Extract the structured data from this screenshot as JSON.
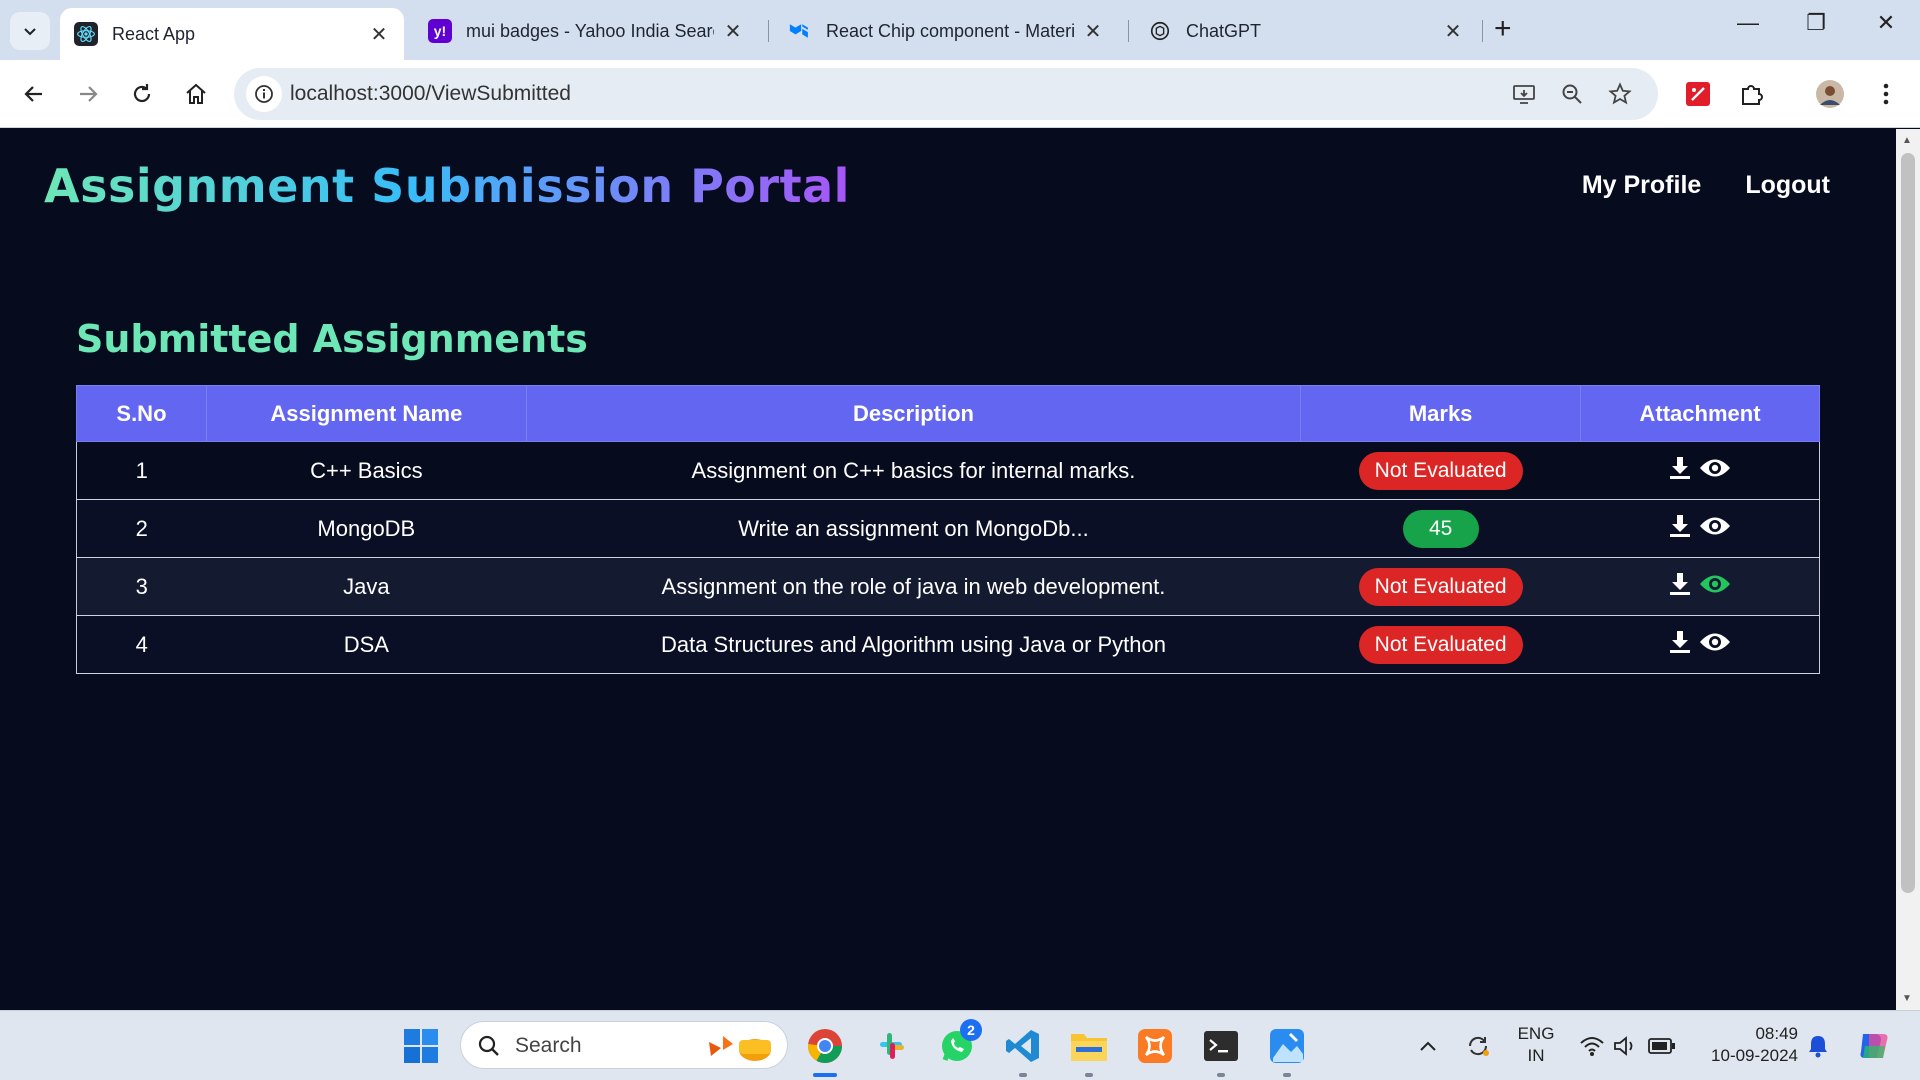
{
  "browser": {
    "tabs": [
      {
        "title": "React App",
        "active": true
      },
      {
        "title": "mui badges - Yahoo India Search",
        "active": false
      },
      {
        "title": "React Chip component - Material UI",
        "active": false
      },
      {
        "title": "ChatGPT",
        "active": false
      }
    ],
    "url": "localhost:3000/ViewSubmitted"
  },
  "app": {
    "brand": "Assignment Submission Portal",
    "nav": {
      "profile": "My Profile",
      "logout": "Logout"
    }
  },
  "page": {
    "section_title": "Submitted Assignments",
    "table": {
      "headers": {
        "sno": "S.No",
        "name": "Assignment Name",
        "description": "Description",
        "marks": "Marks",
        "attachment": "Attachment"
      },
      "rows": [
        {
          "sno": "1",
          "name": "C++ Basics",
          "description": "Assignment on C++ basics for internal marks.",
          "marks": "Not Evaluated"
        },
        {
          "sno": "2",
          "name": "MongoDB",
          "description": "Write an assignment on MongoDb...",
          "marks": "45"
        },
        {
          "sno": "3",
          "name": "Java",
          "description": "Assignment on the role of java in web development.",
          "marks": "Not Evaluated"
        },
        {
          "sno": "4",
          "name": "DSA",
          "description": "Data Structures and Algorithm using Java or Python",
          "marks": "Not Evaluated"
        }
      ]
    }
  },
  "taskbar": {
    "search_label": "Search",
    "whatsapp_badge": "2",
    "lang_line1": "ENG",
    "lang_line2": "IN",
    "time": "08:49",
    "date": "10-09-2024"
  },
  "colors": {
    "page_bg": "#070b1e",
    "table_header": "#6366f1",
    "chip_not_evaluated": "#dc2626",
    "chip_marks": "#16a34a",
    "section_title": "#6ee7b7"
  }
}
